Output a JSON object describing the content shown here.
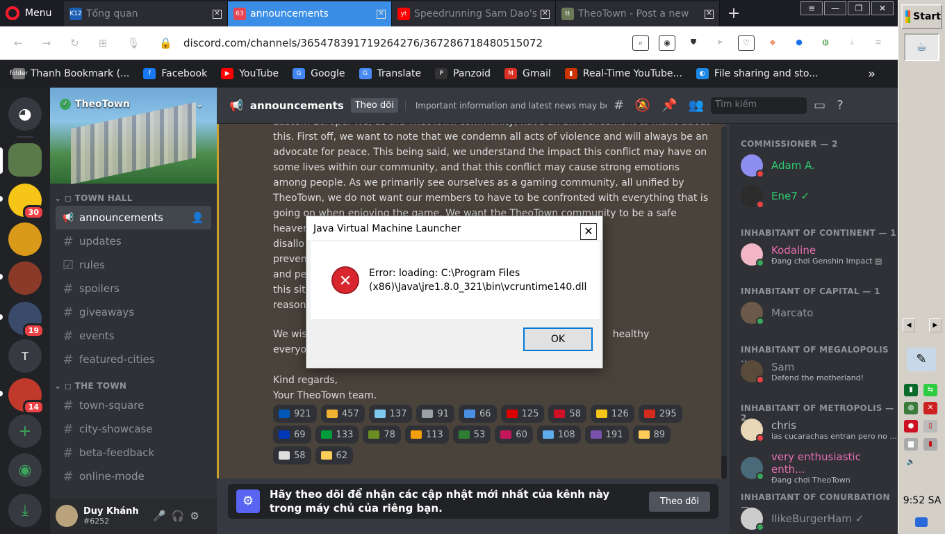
{
  "browser": {
    "menu_label": "Menu",
    "tabs": [
      {
        "label": "Tổng quan",
        "icon": "K12",
        "icon_color": "#1a5fb4"
      },
      {
        "label": "announcements",
        "icon": "63",
        "icon_color": "#e64553"
      },
      {
        "label": "Speedrunning Sam Dao's",
        "icon": "yt",
        "icon_color": "#ff0000"
      },
      {
        "label": "TheoTown - Post a new",
        "icon": "tt",
        "icon_color": "#6a7a56"
      }
    ],
    "url": "discord.com/channels/365478391719264276/367286718480515072",
    "bookmarks": [
      {
        "label": "Thanh Bookmark (...",
        "icon": "folder",
        "color": "#777777"
      },
      {
        "label": "Facebook",
        "icon": "f",
        "color": "#1877f2"
      },
      {
        "label": "YouTube",
        "icon": "▶",
        "color": "#ff0000"
      },
      {
        "label": "Google",
        "icon": "G",
        "color": "#4285f4"
      },
      {
        "label": "Translate",
        "icon": "G",
        "color": "#4a8af4"
      },
      {
        "label": "Panzoid",
        "icon": "P",
        "color": "#333333"
      },
      {
        "label": "Gmail",
        "icon": "M",
        "color": "#d93025"
      },
      {
        "label": "Real-Time YouTube...",
        "icon": "▮",
        "color": "#cc3300"
      },
      {
        "label": "File sharing and sto...",
        "icon": "◐",
        "color": "#1e88e5"
      }
    ],
    "more_label": "»"
  },
  "guilds": [
    {
      "label": "discord",
      "badge": "",
      "color": "#36393f"
    },
    {
      "label": "theotown",
      "badge": "",
      "color": "#5a7a4a"
    },
    {
      "label": "M",
      "badge": "30",
      "color": "#f5c518"
    },
    {
      "label": "star",
      "badge": "",
      "color": "#d99a1a"
    },
    {
      "label": "g4",
      "badge": "",
      "color": "#8b3a2a"
    },
    {
      "label": "g5",
      "badge": "19",
      "color": "#3a4a6a"
    },
    {
      "label": "T",
      "badge": "",
      "color": "#36393f"
    },
    {
      "label": "g7",
      "badge": "14",
      "color": "#c0392b"
    }
  ],
  "server": {
    "name": "TheoTown",
    "categories": [
      {
        "name": "TOWN HALL",
        "channels": [
          {
            "name": "announcements",
            "active": true
          },
          {
            "name": "updates"
          },
          {
            "name": "rules"
          },
          {
            "name": "spoilers"
          },
          {
            "name": "giveaways"
          },
          {
            "name": "events"
          },
          {
            "name": "featured-cities"
          }
        ]
      },
      {
        "name": "THE TOWN",
        "channels": [
          {
            "name": "town-square"
          },
          {
            "name": "city-showcase"
          },
          {
            "name": "beta-feedback"
          },
          {
            "name": "online-mode"
          }
        ]
      }
    ]
  },
  "user": {
    "name": "Duy Khánh",
    "tag": "#6252"
  },
  "header": {
    "channel": "announcements",
    "follow_label": "Theo dõi",
    "topic": "Important information and latest news may be fo...",
    "search_placeholder": "Tìm kiếm"
  },
  "messages": {
    "lines": [
      "Eastern Europe. We, as the TheoTown community, have an announcement to make about",
      "this. First off, we want to note that we condemn all acts of violence and will always be an",
      "advocate for peace. This being said, we understand the impact this conflict may have on",
      "some lives within our community, and that this conflict may cause strong emotions",
      "among people. As we primarily see ourselves as a gaming community, all unified by",
      "TheoTown, we do not want our members to have to be confronted with everything that is",
      "going on when enjoying the game. We want the TheoTown community to be a safe",
      "heaven                                                                    ave decided to",
      "disallo                                                                   This is to both",
      "preven                                                                    space of comfort",
      "and pe                                                                    allowed, and in",
      "this sit                                                                  erstand our",
      "reasoni"
    ],
    "line2a": "We wis",
    "line2b": "healthy",
    "line3": "everyo",
    "sign1": "Kind regards,",
    "sign2": "Your TheoTown team.",
    "reactions": [
      [
        {
          "e": "#0057b7",
          "n": "921"
        },
        {
          "e": "#f0b232",
          "n": "457"
        },
        {
          "e": "#7ec8f0",
          "n": "137"
        },
        {
          "e": "#9aa0a6",
          "n": "91"
        },
        {
          "e": "#4a90e2",
          "n": "66"
        },
        {
          "e": "#dd0000",
          "n": "125"
        },
        {
          "e": "#ce1126",
          "n": "58"
        },
        {
          "e": "#f5c518",
          "n": "126"
        },
        {
          "e": "#d52b1e",
          "n": "295"
        }
      ],
      [
        {
          "e": "#0038b8",
          "n": "69"
        },
        {
          "e": "#009c3b",
          "n": "133"
        },
        {
          "e": "#6b8e23",
          "n": "78"
        },
        {
          "e": "#f59e0b",
          "n": "113"
        },
        {
          "e": "#2e7d32",
          "n": "53"
        },
        {
          "e": "#c2185b",
          "n": "60"
        },
        {
          "e": "#5dadec",
          "n": "108"
        },
        {
          "e": "#7b52ab",
          "n": "191"
        },
        {
          "e": "#fdcb58",
          "n": "89"
        }
      ],
      [
        {
          "e": "#ddd",
          "n": "58"
        },
        {
          "e": "#fdcb58",
          "n": "62"
        }
      ]
    ]
  },
  "follow_bar": {
    "text": "Hãy theo dõi để nhận các cập nhật mới nhất của kênh này trong máy chủ của riêng bạn.",
    "button": "Theo dõi"
  },
  "members": {
    "groups": [
      {
        "title": "COMMISSIONER — 2",
        "members": [
          {
            "name": "Adam A.",
            "color": "#2ecc71",
            "status": "",
            "av": "#8e8ef0",
            "st": "#ed4245"
          },
          {
            "name": "Ene7 ✓",
            "color": "#2ecc71",
            "status": "",
            "av": "#2b2b2b",
            "st": "#ed4245"
          }
        ]
      },
      {
        "title": "INHABITANT OF CONTINENT — 1",
        "members": [
          {
            "name": "Kodaline",
            "color": "#e86fb2",
            "status": "Đang chơi Genshin Impact ▤",
            "av": "#f2b6c6",
            "st": "#3ba55c"
          }
        ]
      },
      {
        "title": "INHABITANT OF CAPITAL — 1",
        "members": [
          {
            "name": "Marcato",
            "color": "#8e9297",
            "status": "",
            "av": "#6b5a4a",
            "st": "#3ba55c"
          }
        ]
      },
      {
        "title": "INHABITANT OF MEGALOPOLIS ...",
        "members": [
          {
            "name": "Sam",
            "color": "#8e9297",
            "status": "Defend the motherland!",
            "av": "#5a4a3a",
            "st": "#ed4245"
          }
        ]
      },
      {
        "title": "INHABITANT OF METROPOLIS — 2",
        "members": [
          {
            "name": "chris",
            "color": "#b9bbbe",
            "status": "las cucarachas entran pero no ...",
            "av": "#e8d8b8",
            "st": "#ed4245"
          },
          {
            "name": "very enthusiastic enth...",
            "color": "#e86fb2",
            "status": "Đang chơi TheoTown",
            "av": "#4a6a7a",
            "st": "#3ba55c"
          }
        ]
      },
      {
        "title": "INHABITANT OF CONURBATION —",
        "members": [
          {
            "name": "IlikeBurgerHam ✓",
            "color": "#8e9297",
            "status": "",
            "av": "#cccccc",
            "st": "#3ba55c"
          }
        ]
      }
    ]
  },
  "dialog": {
    "title": "Java Virtual Machine Launcher",
    "message": "Error: loading: C:\\Program Files (x86)\\Java\\jre1.8.0_321\\bin\\vcruntime140.dll",
    "ok": "OK"
  },
  "taskbar": {
    "start": "Start",
    "clock": "9:52 SA"
  }
}
